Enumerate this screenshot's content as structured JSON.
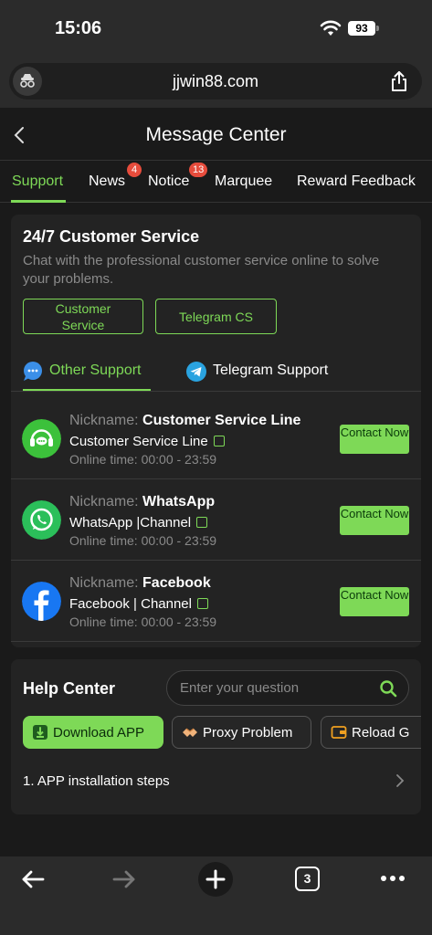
{
  "status_bar": {
    "time": "15:06",
    "battery": "93"
  },
  "browser": {
    "url": "jjwin88.com"
  },
  "header": {
    "title": "Message Center"
  },
  "tabs": [
    {
      "label": "Support",
      "active": true
    },
    {
      "label": "News",
      "badge": "4"
    },
    {
      "label": "Notice",
      "badge": "13"
    },
    {
      "label": "Marquee"
    },
    {
      "label": "Reward Feedback"
    }
  ],
  "customer_service": {
    "title": "24/7 Customer Service",
    "description": "Chat with the professional customer service online to solve your problems.",
    "buttons": [
      "Customer Service",
      "Telegram CS"
    ]
  },
  "support_tabs": [
    {
      "label": "Other Support",
      "active": true
    },
    {
      "label": "Telegram Support"
    }
  ],
  "contacts": [
    {
      "nickname_label": "Nickname:",
      "nickname": "Customer Service Line",
      "channel": "Customer Service Line",
      "online": "Online time:  00:00 - 23:59",
      "button": "Contact Now",
      "icon": "headset-icon"
    },
    {
      "nickname_label": "Nickname:",
      "nickname": "WhatsApp",
      "channel": "WhatsApp |Channel",
      "online": "Online time:  00:00 - 23:59",
      "button": "Contact Now",
      "icon": "whatsapp-icon"
    },
    {
      "nickname_label": "Nickname:",
      "nickname": "Facebook",
      "channel": "Facebook | Channel",
      "online": "Online time:  00:00 - 23:59",
      "button": "Contact Now",
      "icon": "facebook-icon"
    }
  ],
  "help_center": {
    "title": "Help Center",
    "search_placeholder": "Enter your question",
    "chips": [
      "Download APP",
      "Proxy Problem",
      "Reload G"
    ],
    "faq": [
      "1. APP installation steps"
    ]
  },
  "toolbar": {
    "tabs_count": "3"
  },
  "colors": {
    "accent": "#7ed957",
    "badge": "#e74c3c",
    "background": "#1a1a1a",
    "card": "#232323"
  }
}
